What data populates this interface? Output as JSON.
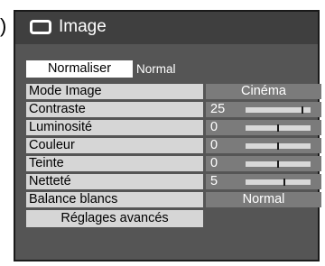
{
  "marker": ")",
  "header": {
    "title": "Image",
    "icon": "screen-icon"
  },
  "normaliser": {
    "label": "Normaliser",
    "value": "Normal"
  },
  "settings": {
    "mode_image": {
      "label": "Mode Image",
      "value": "Cinéma"
    },
    "contraste": {
      "label": "Contraste",
      "value": "25",
      "level": 0.88
    },
    "luminosite": {
      "label": "Luminosité",
      "value": "0",
      "level": 0.5
    },
    "couleur": {
      "label": "Couleur",
      "value": "0",
      "level": 0.5
    },
    "teinte": {
      "label": "Teinte",
      "value": "0",
      "level": 0.5
    },
    "nettete": {
      "label": "Netteté",
      "value": "5",
      "level": 0.6
    },
    "balance_blancs": {
      "label": "Balance blancs",
      "value": "Normal"
    }
  },
  "advanced": {
    "label": "Réglages avancés"
  }
}
